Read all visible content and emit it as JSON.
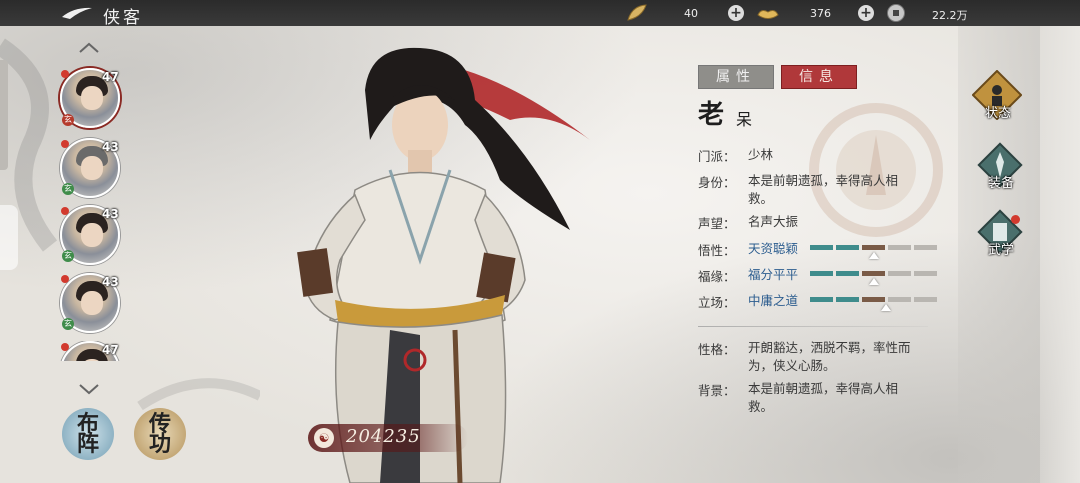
{
  "header": {
    "title": "侠客",
    "resources": [
      {
        "icon": "gold-leaf-icon",
        "value": "40"
      },
      {
        "icon": "ingot-icon",
        "value": "376"
      },
      {
        "icon": "coin-icon",
        "value": "22.2万"
      }
    ]
  },
  "roster": [
    {
      "level": "47",
      "grade": "玄",
      "grade_color": "#b53a2c",
      "selected": true
    },
    {
      "level": "43",
      "grade": "玄",
      "grade_color": "#3f8c4a",
      "selected": false
    },
    {
      "level": "43",
      "grade": "玄",
      "grade_color": "#3f8c4a",
      "selected": false
    },
    {
      "level": "43",
      "grade": "玄",
      "grade_color": "#3f8c4a",
      "selected": false
    },
    {
      "level": "47",
      "grade": "",
      "grade_color": "#3f8c4a",
      "selected": false
    }
  ],
  "bottom_buttons": {
    "formation": "布阵",
    "teach": "传功"
  },
  "power": "204235",
  "tabs": {
    "attributes": "属性",
    "info": "信息"
  },
  "character": {
    "name_main": "老",
    "name_sub": "呆",
    "fields": [
      {
        "key": "门派：",
        "value": "少林",
        "blue": false
      },
      {
        "key": "身份：",
        "value": "本是前朝遗孤，幸得高人相救。",
        "blue": false
      },
      {
        "key": "声望：",
        "value": "名声大振",
        "blue": false
      },
      {
        "key": "悟性：",
        "value": "天资聪颖",
        "blue": true,
        "bar": {
          "filled": 3,
          "marker": 3
        }
      },
      {
        "key": "福缘：",
        "value": "福分平平",
        "blue": true,
        "bar": {
          "filled": 3,
          "marker": 3
        }
      },
      {
        "key": "立场：",
        "value": "中庸之道",
        "blue": true,
        "bar": {
          "filled": 3,
          "marker": 4
        }
      },
      {
        "key": "性格：",
        "value": "开朗豁达，洒脱不羁，率性而为，侠义心肠。",
        "blue": false
      },
      {
        "key": "背景：",
        "value": "本是前朝遗孤，幸得高人相救。",
        "blue": false
      }
    ]
  },
  "side_nav": [
    {
      "label": "状态",
      "icon": "status-icon",
      "active": true
    },
    {
      "label": "装备",
      "icon": "equipment-icon",
      "active": false
    },
    {
      "label": "武学",
      "icon": "martial-arts-icon",
      "active": false
    }
  ]
}
